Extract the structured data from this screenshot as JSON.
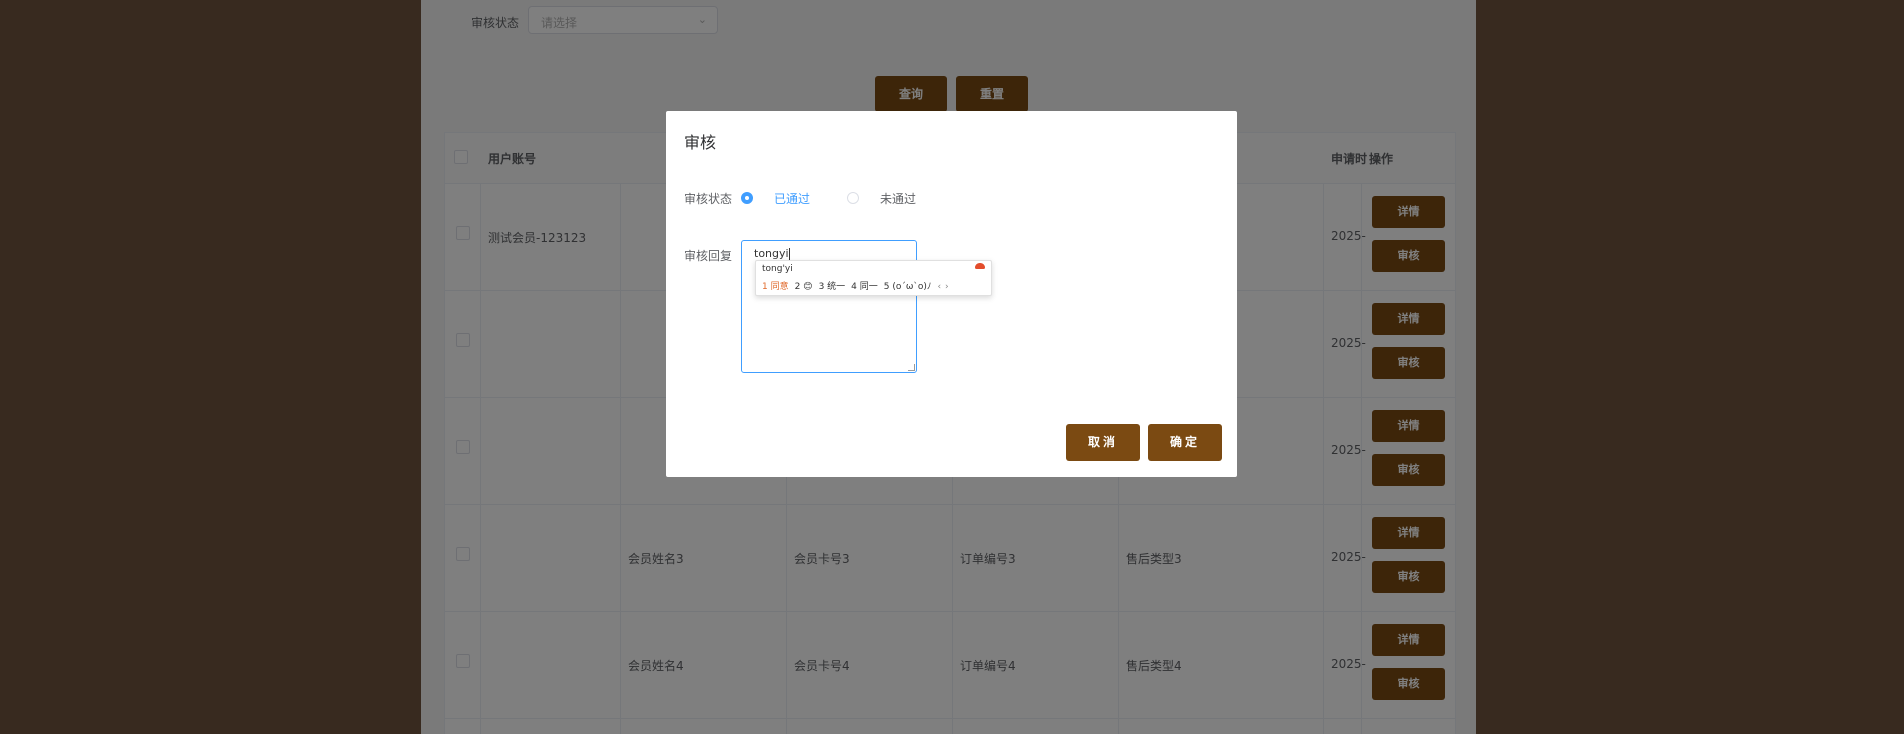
{
  "filter": {
    "label": "审核状态",
    "placeholder": "请选择"
  },
  "buttons": {
    "query": "查询",
    "reset": "重置"
  },
  "table": {
    "headers": [
      "用户账号",
      "申请时",
      "操作"
    ],
    "rows": [
      {
        "account": "测试会员-123123",
        "name": "",
        "card": "",
        "order": "",
        "type": "",
        "date": "2025-"
      },
      {
        "account": "",
        "name": "",
        "card": "",
        "order": "",
        "type": "",
        "date": "2025-"
      },
      {
        "account": "",
        "name": "",
        "card": "",
        "order": "",
        "type": "",
        "date": "2025-"
      },
      {
        "account": "",
        "name": "会员姓名3",
        "card": "会员卡号3",
        "order": "订单编号3",
        "type": "售后类型3",
        "date": "2025-"
      },
      {
        "account": "",
        "name": "会员姓名4",
        "card": "会员卡号4",
        "order": "订单编号4",
        "type": "售后类型4",
        "date": "2025-"
      }
    ],
    "action_detail": "详情",
    "action_review": "审核"
  },
  "dialog": {
    "title": "审核",
    "status_label": "审核状态",
    "option_passed": "已通过",
    "option_failed": "未通过",
    "reply_label": "审核回复",
    "reply_value": "tongyi",
    "cancel": "取消",
    "confirm": "确定"
  },
  "ime": {
    "pinyin": "tong'yi",
    "candidates": [
      "1 同意",
      "2 😊",
      "3 统一",
      "4 同一",
      "5 (o´ω`o)ﾉ"
    ]
  },
  "colors": {
    "brand": "#7b4a12",
    "accent": "#409eff",
    "side": "#70553f"
  }
}
